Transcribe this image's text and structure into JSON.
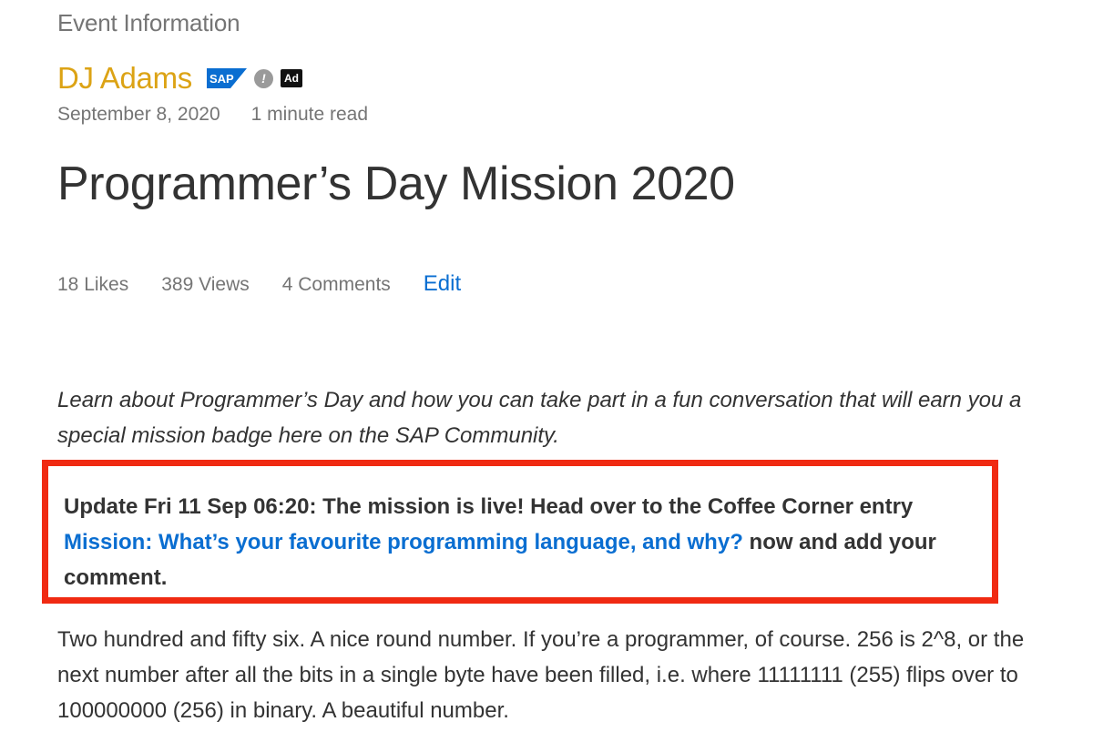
{
  "section_label": "Event Information",
  "author": {
    "name": "DJ Adams",
    "sap_badge": "SAP",
    "help_icon": "help-icon",
    "ad_badge": "Ad"
  },
  "meta": {
    "date": "September 8, 2020",
    "read_time": "1 minute read"
  },
  "title": "Programmer’s Day Mission 2020",
  "stats": {
    "likes": "18 Likes",
    "views": "389 Views",
    "comments": "4 Comments",
    "edit_label": "Edit"
  },
  "intro": "Learn about Programmer’s Day and how you can take part in a fun conversation that will earn you a special mission badge here on the SAP Community.",
  "update": {
    "prefix": "Update Fri 11 Sep 06:20: The mission is live! Head over to the Coffee Corner entry ",
    "link_text": "Mission: What’s your favourite programming language, and why?",
    "suffix": "  now and add your comment."
  },
  "body": "Two hundred and fifty six. A nice round number. If you’re a programmer, of course. 256 is 2^8, or the next number after all the bits in a single byte have been filled, i.e. where 11111111 (255) flips over to 100000000 (256) in binary. A beautiful number.",
  "colors": {
    "author": "#dca315",
    "link": "#0a6ed1",
    "highlight_border": "#f02a12",
    "muted": "#757575",
    "text": "#333333"
  }
}
